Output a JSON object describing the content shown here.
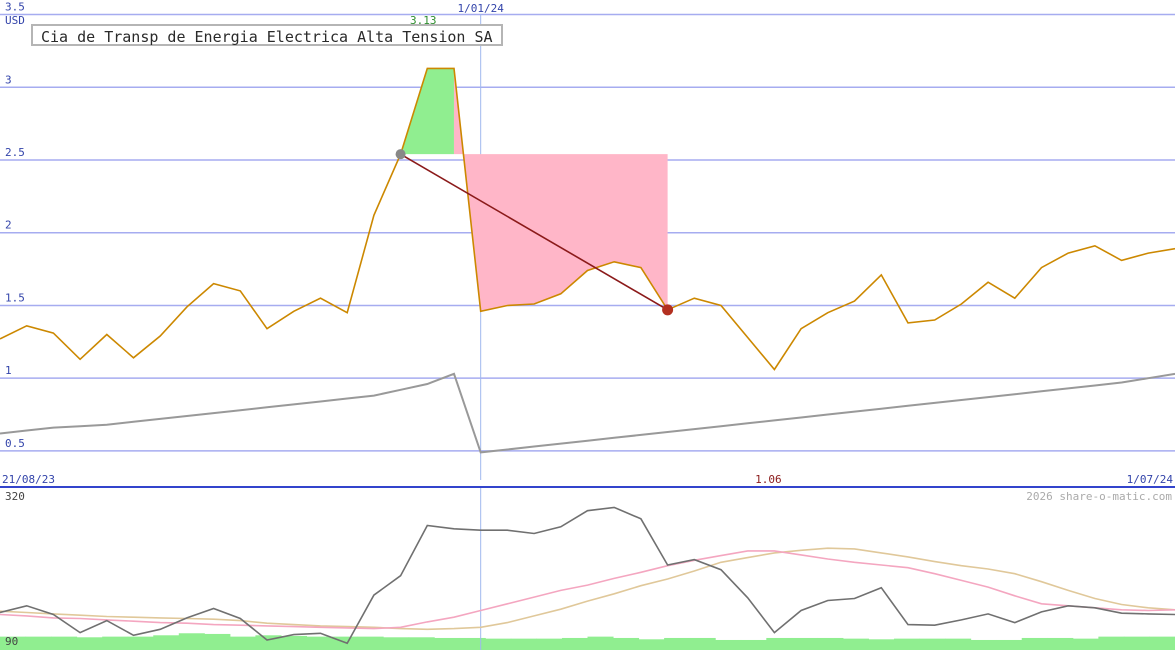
{
  "chart_data": [
    {
      "type": "line",
      "title": "Cia de Transp de Energia Electrica Alta Tension SA",
      "ylabel": "USD",
      "ylim": [
        0.3,
        3.6
      ],
      "yticks": [
        0.5,
        1,
        1.5,
        2,
        2.5,
        3,
        3.5
      ],
      "ytick_labels": [
        "0.5",
        "1",
        "1.5",
        "2",
        "2.5",
        "3",
        "3.5"
      ],
      "grid": true,
      "x_start_label": "21/08/23",
      "x_end_label": "1/07/24",
      "x_marker_label": "1/01/24",
      "x_marker_index": 18,
      "annotations": {
        "high": {
          "label": "3.13",
          "index": 16,
          "value": 3.13,
          "color": "#2f8f2f"
        },
        "low": {
          "label": "1.06",
          "index": 29,
          "value": 1.06,
          "color": "#8b1a1a"
        }
      },
      "trade": {
        "entry": {
          "index": 15,
          "value": 2.54
        },
        "exit": {
          "index": 25,
          "value": 1.47
        }
      },
      "colors": {
        "price": "#cc8800",
        "trend": "#999999",
        "gain": "#90ee90",
        "loss": "#ffb6c8",
        "trade_line": "#8b1a1a",
        "grid": "#a6acf0",
        "marker": "#a0b8ee"
      },
      "series": [
        {
          "role": "price",
          "values": [
            1.27,
            1.36,
            1.31,
            1.13,
            1.3,
            1.14,
            1.29,
            1.49,
            1.65,
            1.6,
            1.34,
            1.46,
            1.55,
            1.45,
            2.12,
            2.54,
            3.13,
            3.13,
            1.46,
            1.5,
            1.51,
            1.58,
            1.74,
            1.8,
            1.76,
            1.47,
            1.55,
            1.5,
            1.28,
            1.06,
            1.34,
            1.45,
            1.53,
            1.71,
            1.38,
            1.4,
            1.51,
            1.66,
            1.55,
            1.76,
            1.86,
            1.91,
            1.81,
            1.86,
            1.89
          ]
        },
        {
          "role": "trend",
          "values": [
            0.62,
            0.64,
            0.66,
            0.67,
            0.68,
            0.7,
            0.72,
            0.74,
            0.76,
            0.78,
            0.8,
            0.82,
            0.84,
            0.86,
            0.88,
            0.92,
            0.96,
            1.03,
            0.49,
            0.51,
            0.53,
            0.55,
            0.57,
            0.59,
            0.61,
            0.63,
            0.65,
            0.67,
            0.69,
            0.71,
            0.73,
            0.75,
            0.77,
            0.79,
            0.81,
            0.83,
            0.85,
            0.87,
            0.89,
            0.91,
            0.93,
            0.95,
            0.97,
            1.0,
            1.03
          ]
        }
      ]
    },
    {
      "type": "line",
      "watermark": "2026 share-o-matic.com",
      "ylim": [
        90,
        320
      ],
      "yticks": [
        90,
        320
      ],
      "ytick_labels": [
        "90",
        "320"
      ],
      "colors": {
        "volume": "#90ee90",
        "line": "#707070",
        "pink": "#f4a6c0",
        "tan": "#e0c89a"
      },
      "volume": [
        104,
        104,
        104,
        103,
        104,
        104,
        106,
        109,
        108,
        104,
        106,
        105,
        104,
        104,
        104,
        103,
        103,
        102,
        102,
        101,
        101,
        101,
        102,
        104,
        102,
        100,
        102,
        102,
        99,
        99,
        102,
        102,
        102,
        101,
        100,
        101,
        101,
        101,
        99,
        99,
        102,
        102,
        101,
        104,
        104,
        104
      ],
      "series": [
        {
          "role": "dark",
          "values": [
            140,
            150,
            137,
            110,
            128,
            106,
            115,
            132,
            146,
            131,
            99,
            107,
            109,
            94,
            166,
            195,
            270,
            265,
            263,
            263,
            258,
            268,
            292,
            297,
            280,
            211,
            219,
            204,
            162,
            110,
            143,
            158,
            161,
            177,
            122,
            121,
            129,
            138,
            125,
            141,
            150,
            147,
            139,
            138,
            137
          ]
        },
        {
          "role": "pink",
          "values": [
            137,
            135,
            132,
            131,
            129,
            127,
            125,
            124,
            122,
            121,
            120,
            119,
            118,
            117,
            116,
            118,
            126,
            133,
            143,
            153,
            163,
            173,
            181,
            191,
            200,
            210,
            218,
            225,
            232,
            232,
            226,
            220,
            215,
            211,
            207,
            198,
            188,
            178,
            165,
            153,
            150,
            147,
            144,
            143,
            144
          ]
        },
        {
          "role": "tan",
          "values": [
            142,
            140,
            138,
            136,
            134,
            133,
            132,
            131,
            130,
            128,
            124,
            122,
            120,
            119,
            118,
            116,
            115,
            116,
            118,
            125,
            135,
            145,
            157,
            168,
            180,
            190,
            202,
            215,
            222,
            229,
            233,
            236,
            235,
            229,
            223,
            216,
            210,
            205,
            198,
            186,
            173,
            161,
            152,
            147,
            144
          ]
        }
      ]
    }
  ]
}
